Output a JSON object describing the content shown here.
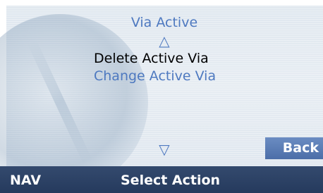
{
  "menu": {
    "title": "Via Active",
    "arrow_up": "△",
    "items": [
      {
        "label": "Delete Active Via",
        "selected": true
      },
      {
        "label": "Change Active Via",
        "selected": false
      }
    ],
    "arrow_down": "▽"
  },
  "back_button": {
    "label": "Back"
  },
  "bottom_bar": {
    "mode": "NAV",
    "status": "Select Action"
  },
  "colors": {
    "accent": "#4e79c0",
    "selected_text": "#000000",
    "bar_background": "#2d4266",
    "button_background": "#5a7bb5"
  }
}
